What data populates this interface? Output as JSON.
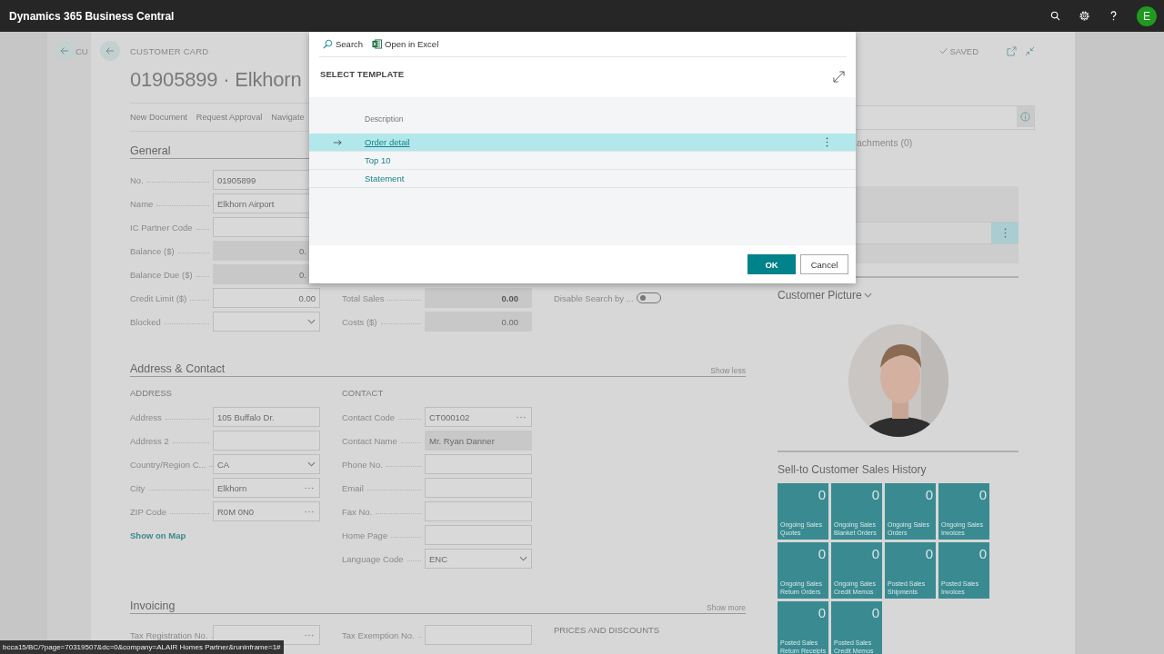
{
  "top_bar": {
    "app_title": "Dynamics 365 Business Central",
    "avatar_initial": "E"
  },
  "back_page": {
    "caption": "CU"
  },
  "card": {
    "caption": "CUSTOMER CARD",
    "title": "01905899 · Elkhorn",
    "status": "SAVED",
    "actions": [
      "New Document",
      "Request Approval",
      "Navigate"
    ],
    "sections": [
      {
        "title": "General",
        "columns": [
          {
            "fields": [
              {
                "label": "No.",
                "kind": "text",
                "value": "01905899"
              },
              {
                "label": "Name",
                "kind": "text",
                "value": "Elkhorn Airport"
              },
              {
                "label": "IC Partner Code",
                "kind": "text"
              },
              {
                "label": "Balance ($)",
                "kind": "readonly_number",
                "value": "0."
              },
              {
                "label": "Balance Due ($)",
                "kind": "readonly_number",
                "value": "0."
              },
              {
                "label": "Credit Limit ($)",
                "kind": "number",
                "value": "0.00"
              },
              {
                "label": "Blocked",
                "kind": "dropdown"
              }
            ]
          },
          {
            "fields": [
              {
                "label": "Total Sales",
                "kind": "readonly_number",
                "value": "0.00",
                "bold": true
              },
              {
                "label": "Costs ($)",
                "kind": "readonly_number",
                "value": "0.00"
              }
            ]
          },
          {
            "fields": [
              {
                "label": "Disable Search by ...",
                "kind": "toggle",
                "on": false
              }
            ]
          }
        ]
      },
      {
        "title": "Address & Contact",
        "toggle_label": "Show less",
        "columns": [
          {
            "heading": "ADDRESS",
            "fields": [
              {
                "label": "Address",
                "kind": "text",
                "value": "105 Buffalo Dr."
              },
              {
                "label": "Address 2",
                "kind": "text"
              },
              {
                "label": "Country/Region C...",
                "kind": "dropdown",
                "value": "CA"
              },
              {
                "label": "City",
                "kind": "lookup",
                "value": "Elkhorn"
              },
              {
                "label": "ZIP Code",
                "kind": "lookup",
                "value": "R0M 0N0"
              }
            ],
            "link": "Show on Map"
          },
          {
            "heading": "CONTACT",
            "fields": [
              {
                "label": "Contact Code",
                "kind": "lookup",
                "value": "CT000102"
              },
              {
                "label": "Contact Name",
                "kind": "readonly",
                "value": "Mr. Ryan Danner"
              },
              {
                "label": "Phone No.",
                "kind": "text"
              },
              {
                "label": "Email",
                "kind": "text"
              },
              {
                "label": "Fax No.",
                "kind": "text"
              },
              {
                "label": "Home Page",
                "kind": "text"
              },
              {
                "label": "Language Code",
                "kind": "dropdown",
                "value": "ENC"
              }
            ]
          }
        ]
      },
      {
        "title": "Invoicing",
        "toggle_label": "Show more",
        "columns": [
          {
            "fields": [
              {
                "label": "Tax Registration No.",
                "kind": "lookup"
              }
            ]
          },
          {
            "fields": [
              {
                "label": "Tax Exemption No.",
                "kind": "text"
              }
            ]
          },
          {
            "heading": "PRICES AND DISCOUNTS"
          }
        ]
      }
    ]
  },
  "factbox": {
    "attachments_label": "achments (0)",
    "picture_title": "Customer Picture",
    "history_title": "Sell-to Customer Sales History",
    "tiles": [
      {
        "value": "0",
        "lines": [
          "Ongoing Sales",
          "Quotes"
        ]
      },
      {
        "value": "0",
        "lines": [
          "Ongoing Sales",
          "Blanket Orders"
        ]
      },
      {
        "value": "0",
        "lines": [
          "Ongoing Sales",
          "Orders"
        ]
      },
      {
        "value": "0",
        "lines": [
          "Ongoing Sales",
          "Invoices"
        ]
      },
      {
        "value": "0",
        "lines": [
          "Ongoing Sales",
          "Return Orders"
        ]
      },
      {
        "value": "0",
        "lines": [
          "Ongoing Sales",
          "Credit Memos"
        ]
      },
      {
        "value": "0",
        "lines": [
          "Posted Sales",
          "Shipments"
        ]
      },
      {
        "value": "0",
        "lines": [
          "Posted Sales",
          "Invoices"
        ]
      },
      {
        "value": "0",
        "lines": [
          "Posted Sales",
          "Return Receipts"
        ]
      },
      {
        "value": "0",
        "lines": [
          "Posted Sales",
          "Credit Memos"
        ]
      }
    ]
  },
  "dialog": {
    "toolbar": [
      {
        "label": "Search",
        "kind": "search"
      },
      {
        "label": "Open in Excel",
        "kind": "excel"
      }
    ],
    "title": "SELECT TEMPLATE",
    "column": "Description",
    "rows": [
      {
        "name": "Order detail",
        "selected": true
      },
      {
        "name": "Top 10",
        "selected": false
      },
      {
        "name": "Statement",
        "selected": false
      }
    ],
    "buttons": [
      {
        "label": "OK",
        "kind": "primary"
      },
      {
        "label": "Cancel",
        "kind": "secondary"
      }
    ]
  },
  "status_url": "bcca15/BC/?page=70319507&dc=0&company=ALAIR Homes Partner&runinframe=1#"
}
